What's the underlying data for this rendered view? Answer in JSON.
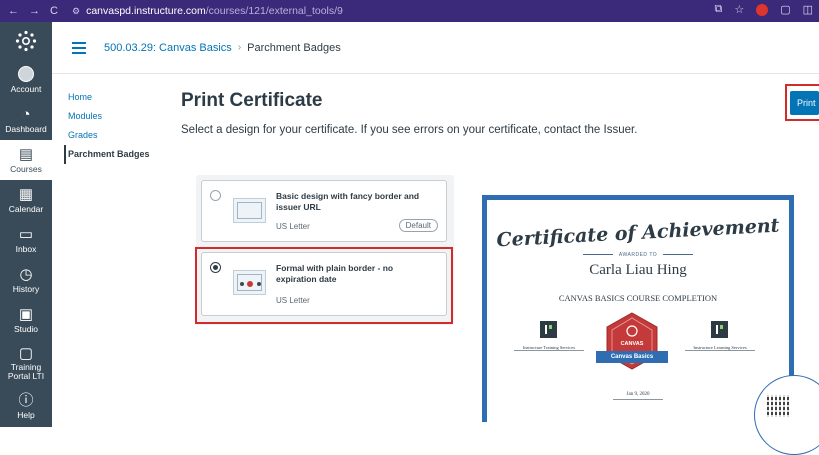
{
  "browser": {
    "back": "←",
    "forward": "→",
    "reload": "C",
    "host": "canvaspd.instructure.com",
    "path": "/courses/121/external_tools/9"
  },
  "global_nav": {
    "items": [
      {
        "label": "Account",
        "icon": "account-icon"
      },
      {
        "label": "Dashboard",
        "icon": "dashboard-icon"
      },
      {
        "label": "Courses",
        "icon": "courses-icon",
        "active": true
      },
      {
        "label": "Calendar",
        "icon": "calendar-icon"
      },
      {
        "label": "Inbox",
        "icon": "inbox-icon"
      },
      {
        "label": "History",
        "icon": "history-icon"
      },
      {
        "label": "Studio",
        "icon": "studio-icon"
      },
      {
        "label": "Training Portal LTI",
        "icon": "training-portal-icon"
      },
      {
        "label": "Help",
        "icon": "help-icon"
      }
    ]
  },
  "breadcrumb": {
    "course": "500.03.29: Canvas Basics",
    "separator": "›",
    "page": "Parchment Badges"
  },
  "course_nav": {
    "items": [
      "Home",
      "Modules",
      "Grades",
      "Parchment Badges"
    ],
    "active": "Parchment Badges"
  },
  "main": {
    "title": "Print Certificate",
    "subtitle": "Select a design for your certificate. If you see errors on your certificate, contact the Issuer.",
    "print_label": "Print"
  },
  "designs": [
    {
      "name": "Basic design with fancy border and issuer URL",
      "size": "US Letter",
      "badge": "Default",
      "selected": false
    },
    {
      "name": "Formal with plain border - no expiration date",
      "size": "US Letter",
      "badge": "",
      "selected": true
    }
  ],
  "certificate": {
    "title": "Certificate of Achievement",
    "awarded_to": "AWARDED TO",
    "recipient": "Carla Liau Hing",
    "course": "CANVAS BASICS COURSE COMPLETION",
    "left_signer": "Instructure Training Services",
    "right_signer": "Instructure Learning Services",
    "badge_top": "CANVAS",
    "badge_name": "Canvas Basics",
    "date": "Jan 9, 2020",
    "colors": {
      "border": "#2f6db3",
      "badge": "#c43a3a"
    }
  },
  "colors": {
    "accent": "#0374b5",
    "global_nav_bg": "#394b58",
    "highlight": "#d42a2a",
    "browser_bar": "#3b2a7a"
  }
}
